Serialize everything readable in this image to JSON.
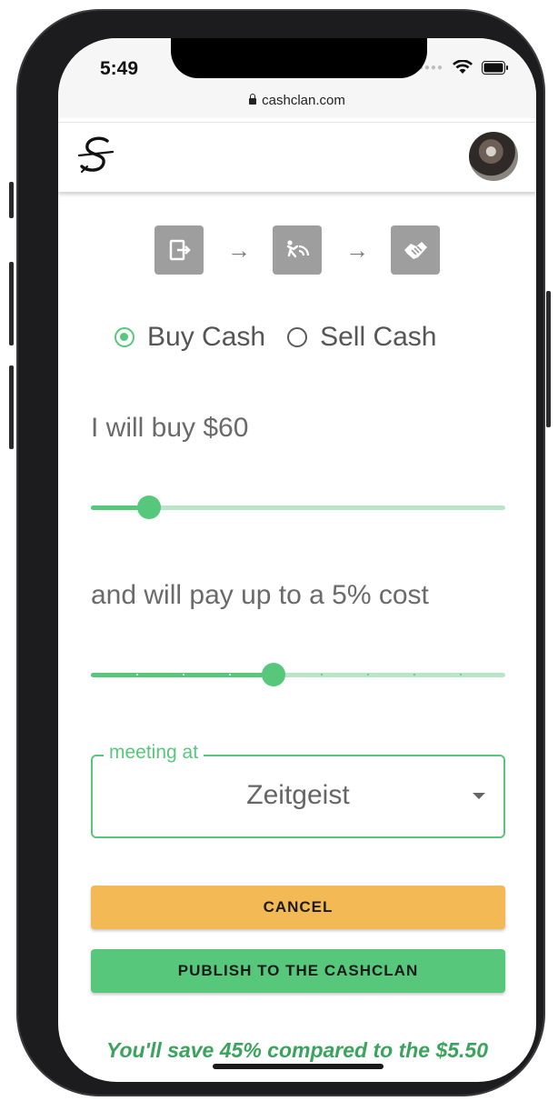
{
  "status_bar": {
    "time": "5:49",
    "url": "cashclan.com"
  },
  "header": {
    "logo_icon": "cashclan-s-logo-icon",
    "avatar": "user-avatar"
  },
  "steps": [
    {
      "icon": "exit-door-icon"
    },
    {
      "icon": "walking-wave-icon"
    },
    {
      "icon": "handshake-icon"
    }
  ],
  "trade_type": {
    "options": [
      {
        "label": "Buy Cash",
        "selected": true
      },
      {
        "label": "Sell Cash",
        "selected": false
      }
    ]
  },
  "amount": {
    "label": "I will buy $60",
    "value": 60,
    "slider_fraction": 0.14
  },
  "cost": {
    "label": "and will pay up to a 5% cost",
    "value_percent": 5,
    "slider_fraction": 0.44
  },
  "meeting": {
    "legend": "meeting at",
    "value": "Zeitgeist"
  },
  "buttons": {
    "cancel": "CANCEL",
    "publish": "PUBLISH TO THE CASHCLAN"
  },
  "savings_text": "You'll save 45% compared to the $5.50",
  "colors": {
    "primary": "#57c77c",
    "cancel": "#f2b954",
    "savings": "#3aa35d"
  }
}
